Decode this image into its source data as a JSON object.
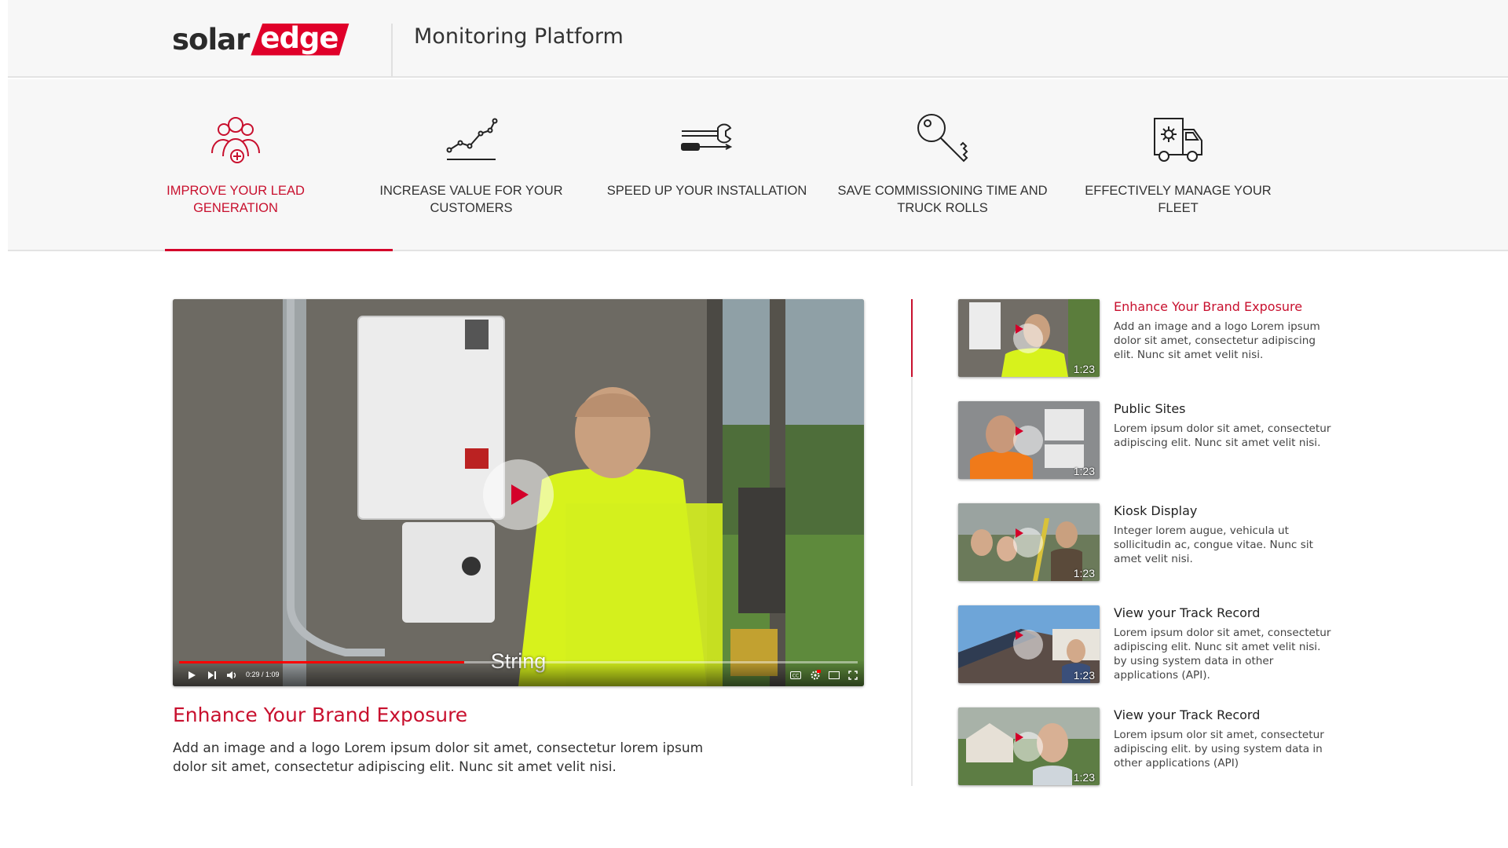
{
  "header": {
    "logo_left": "solar",
    "logo_right": "edge",
    "title": "Monitoring Platform"
  },
  "tabs": [
    {
      "label": "IMPROVE YOUR LEAD GENERATION",
      "icon": "users-plus-icon",
      "active": true
    },
    {
      "label": "INCREASE VALUE FOR YOUR CUSTOMERS",
      "icon": "line-chart-icon",
      "active": false
    },
    {
      "label": "SPEED UP YOUR INSTALLATION",
      "icon": "tools-icon",
      "active": false
    },
    {
      "label": "SAVE COMMISSIONING TIME AND TRUCK ROLLS",
      "icon": "key-icon",
      "active": false
    },
    {
      "label": "EFFECTIVELY MANAGE YOUR FLEET",
      "icon": "truck-icon",
      "active": false
    }
  ],
  "video": {
    "caption": "String",
    "time": "0:29 / 1:09",
    "progress": 0.42,
    "title": "Enhance Your Brand Exposure",
    "description": "Add an image and a logo Lorem ipsum dolor sit amet, consectetur lorem ipsum dolor sit amet, consectetur adipiscing elit. Nunc sit amet velit nisi."
  },
  "playlist": [
    {
      "title": "Enhance Your Brand Exposure",
      "description": "Add an image and a logo Lorem ipsum dolor sit amet, consectetur adipiscing elit. Nunc sit amet velit nisi.",
      "duration": "1:23",
      "active": true
    },
    {
      "title": "Public Sites",
      "description": "Lorem ipsum dolor sit amet, consectetur adipiscing elit. Nunc sit amet velit nisi.",
      "duration": "1:23",
      "active": false
    },
    {
      "title": "Kiosk Display",
      "description": "Integer lorem augue, vehicula ut sollicitudin ac, congue vitae. Nunc sit amet velit nisi.",
      "duration": "1:23",
      "active": false
    },
    {
      "title": "View your Track Record",
      "description": "Lorem ipsum dolor sit amet, consectetur adipiscing elit. Nunc sit amet velit nisi. by using system data in other applications (API).",
      "duration": "1:23",
      "active": false
    },
    {
      "title": "View your Track Record",
      "description": "Lorem ipsum olor sit amet, consectetur adipiscing elit. by using system data in other applications (API)",
      "duration": "1:23",
      "active": false
    }
  ],
  "colors": {
    "accent": "#c8102e",
    "brand_red": "#e0002a",
    "background": "#f7f7f7"
  }
}
